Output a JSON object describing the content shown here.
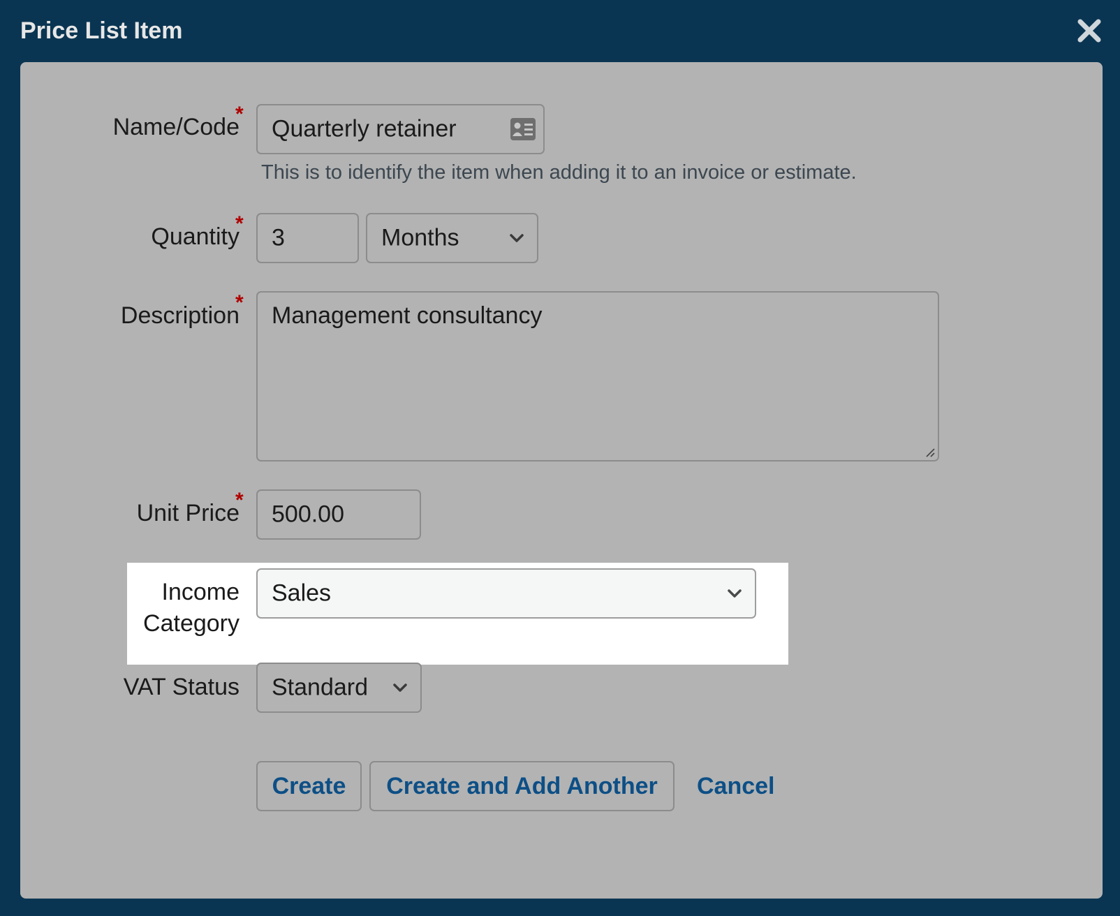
{
  "dialog": {
    "title": "Price List Item"
  },
  "form": {
    "name_code": {
      "label": "Name/Code",
      "value": "Quarterly retainer",
      "help": "This is to identify the item when adding it to an invoice or estimate."
    },
    "quantity": {
      "label": "Quantity",
      "value": "3",
      "unit_selected": "Months"
    },
    "description": {
      "label": "Description",
      "value": "Management consultancy"
    },
    "unit_price": {
      "label": "Unit Price",
      "value": "500.00"
    },
    "income_category": {
      "label_line1": "Income",
      "label_line2": "Category",
      "selected": "Sales"
    },
    "vat_status": {
      "label": "VAT Status",
      "selected": "Standard"
    },
    "required_marker": "*"
  },
  "actions": {
    "create_label": "Create",
    "create_another_label": "Create and Add Another",
    "cancel_label": "Cancel"
  },
  "colors": {
    "backdrop": "#0a3552",
    "panel": "#b3b3b3",
    "link": "#0d4f86",
    "required": "#b00000",
    "highlight": "#ffffff"
  },
  "icons": {
    "close": "close-icon",
    "contact_card": "contact-card-icon",
    "chevron": "chevron-down-icon",
    "resize": "resize-grip-icon"
  }
}
